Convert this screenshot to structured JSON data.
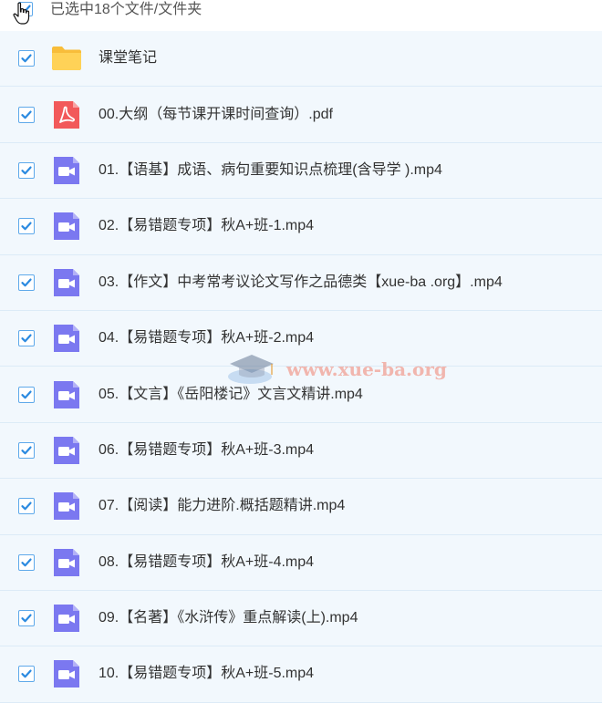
{
  "header": {
    "selection_text": "已选中18个文件/文件夹"
  },
  "colors": {
    "accent": "#2b8ae0",
    "row_bg": "#f2f8fd",
    "folder": "#ffc94a",
    "pdf": "#f2595a",
    "video": "#7b78f0"
  },
  "files": [
    {
      "name": "课堂笔记",
      "type": "folder",
      "icon": "folder-icon",
      "checked": true
    },
    {
      "name": "00.大纲（每节课开课时间查询）.pdf",
      "type": "pdf",
      "icon": "pdf-icon",
      "checked": true
    },
    {
      "name": "01.【语基】成语、病句重要知识点梳理(含导学 ).mp4",
      "type": "video",
      "icon": "video-icon",
      "checked": true
    },
    {
      "name": "02.【易错题专项】秋A+班-1.mp4",
      "type": "video",
      "icon": "video-icon",
      "checked": true
    },
    {
      "name": "03.【作文】中考常考议论文写作之品德类【xue-ba .org】.mp4",
      "type": "video",
      "icon": "video-icon",
      "checked": true
    },
    {
      "name": "04.【易错题专项】秋A+班-2.mp4",
      "type": "video",
      "icon": "video-icon",
      "checked": true
    },
    {
      "name": "05.【文言】《岳阳楼记》文言文精讲.mp4",
      "type": "video",
      "icon": "video-icon",
      "checked": true
    },
    {
      "name": "06.【易错题专项】秋A+班-3.mp4",
      "type": "video",
      "icon": "video-icon",
      "checked": true
    },
    {
      "name": "07.【阅读】能力进阶.概括题精讲.mp4",
      "type": "video",
      "icon": "video-icon",
      "checked": true
    },
    {
      "name": "08.【易错题专项】秋A+班-4.mp4",
      "type": "video",
      "icon": "video-icon",
      "checked": true
    },
    {
      "name": "09.【名著】《水浒传》重点解读(上).mp4",
      "type": "video",
      "icon": "video-icon",
      "checked": true
    },
    {
      "name": "10.【易错题专项】秋A+班-5.mp4",
      "type": "video",
      "icon": "video-icon",
      "checked": true
    }
  ],
  "watermark": {
    "text": "www.xue-ba.org"
  }
}
